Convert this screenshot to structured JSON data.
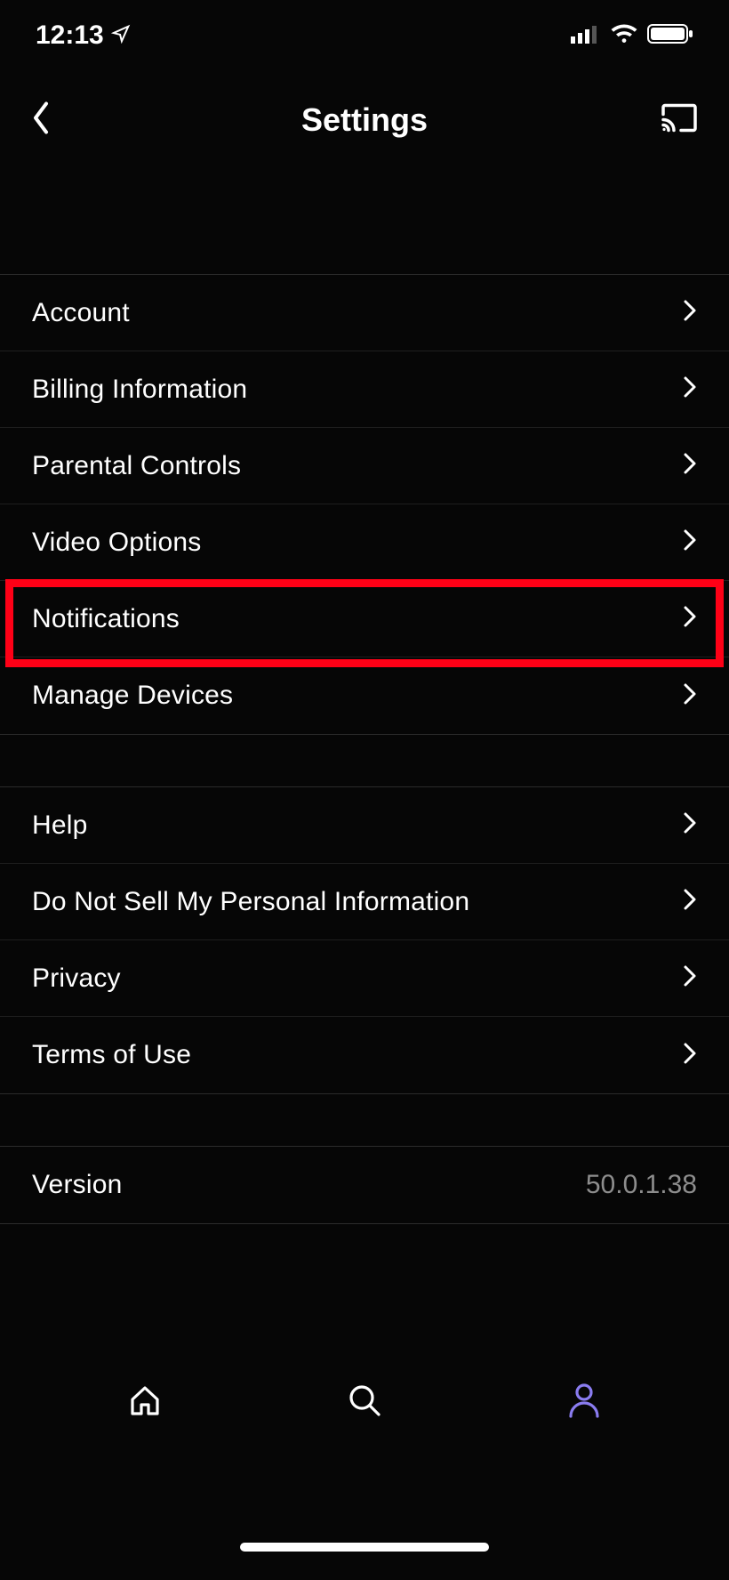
{
  "status_bar": {
    "time": "12:13",
    "icons": {
      "location": "location-arrow-icon",
      "cellular": "cellular-signal-icon",
      "wifi": "wifi-icon",
      "battery": "battery-icon"
    }
  },
  "header": {
    "back_label": "Back",
    "title": "Settings",
    "cast_label": "Cast"
  },
  "groups": [
    {
      "rows": [
        {
          "label": "Account"
        },
        {
          "label": "Billing Information"
        },
        {
          "label": "Parental Controls"
        },
        {
          "label": "Video Options"
        },
        {
          "label": "Notifications",
          "highlighted": true
        },
        {
          "label": "Manage Devices"
        }
      ]
    },
    {
      "rows": [
        {
          "label": "Help"
        },
        {
          "label": "Do Not Sell My Personal Information"
        },
        {
          "label": "Privacy"
        },
        {
          "label": "Terms of Use"
        }
      ]
    },
    {
      "rows": [
        {
          "label": "Version",
          "value": "50.0.1.38",
          "no_chevron": true
        }
      ]
    }
  ],
  "tabs": {
    "home": "Home",
    "search": "Search",
    "profile": "Profile",
    "active": "profile"
  },
  "colors": {
    "accent": "#8a7cf0",
    "highlight": "#ff0016"
  }
}
